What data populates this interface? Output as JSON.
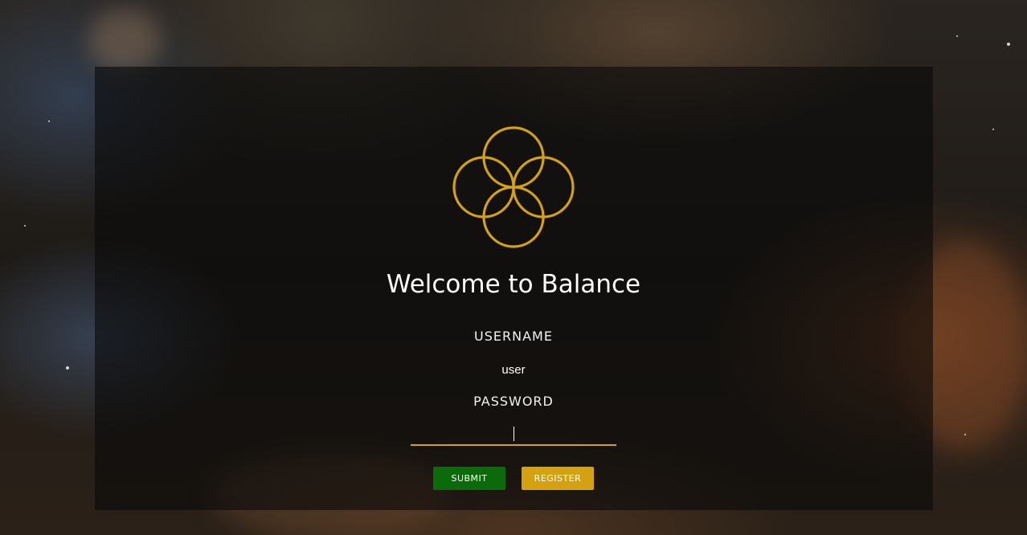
{
  "colors": {
    "accent": "#d4a20f",
    "submit": "#0b6b0b",
    "panel": "rgba(10,10,10,0.62)"
  },
  "logo": {
    "icon": "flower-of-life-icon"
  },
  "title": "Welcome to Balance",
  "form": {
    "username_label": "USERNAME",
    "username_value": "user",
    "password_label": "PASSWORD",
    "password_value": ""
  },
  "buttons": {
    "submit": "SUBMIT",
    "register": "REGISTER"
  }
}
